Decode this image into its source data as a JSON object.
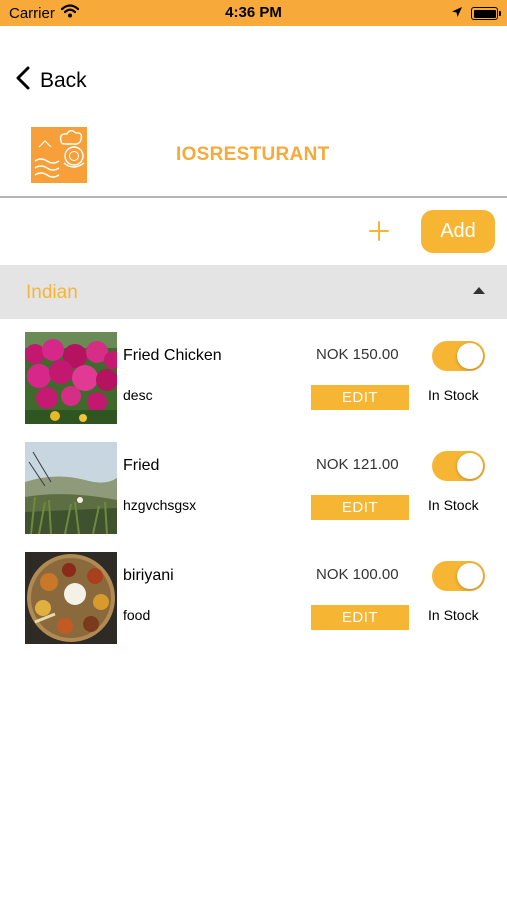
{
  "status_bar": {
    "carrier": "Carrier",
    "time": "4:36 PM"
  },
  "nav": {
    "back_label": "Back"
  },
  "restaurant": {
    "name": "IOSRESTURANT"
  },
  "toolbar": {
    "add_label": "Add"
  },
  "colors": {
    "accent": "#f7b534",
    "status_bar": "#f7a93a",
    "section_bg": "#e4e4e4"
  },
  "section": {
    "title": "Indian",
    "expanded": true
  },
  "items": [
    {
      "name": "Fried Chicken",
      "desc": "desc",
      "price": "NOK 150.00",
      "edit_label": "EDIT",
      "stock_label": "In Stock",
      "in_stock": true
    },
    {
      "name": "Fried",
      "desc": "hzgvchsgsx",
      "price": "NOK 121.00",
      "edit_label": "EDIT",
      "stock_label": "In Stock",
      "in_stock": true
    },
    {
      "name": "biriyani",
      "desc": "food",
      "price": "NOK 100.00",
      "edit_label": "EDIT",
      "stock_label": "In Stock",
      "in_stock": true
    }
  ]
}
